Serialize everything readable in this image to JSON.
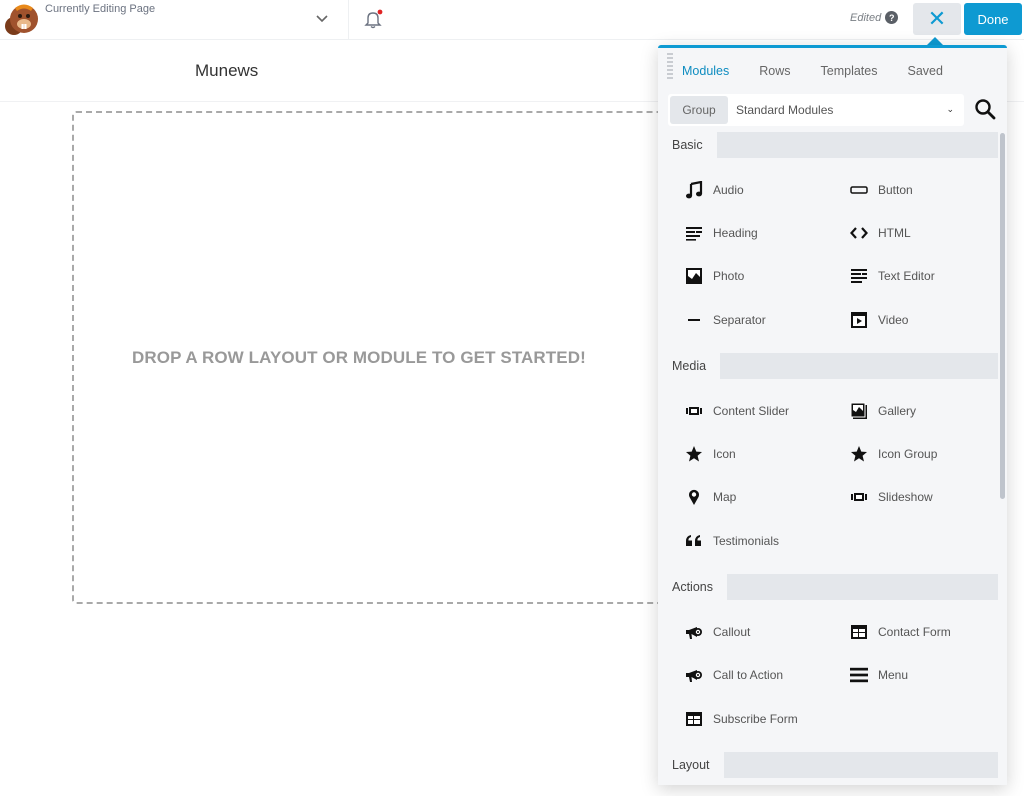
{
  "topbar": {
    "page_label": "Currently Editing Page",
    "edited_label": "Edited",
    "help_glyph": "?",
    "close_glyph": "✕",
    "done_label": "Done",
    "notification_dot": true
  },
  "canvas": {
    "site_title": "Munews",
    "drop_message": "DROP A ROW LAYOUT OR MODULE TO GET STARTED!"
  },
  "panel": {
    "tabs": [
      {
        "label": "Modules",
        "active": true
      },
      {
        "label": "Rows",
        "active": false
      },
      {
        "label": "Templates",
        "active": false
      },
      {
        "label": "Saved",
        "active": false
      }
    ],
    "group_label": "Group",
    "group_value": "Standard Modules",
    "sections": [
      {
        "title": "Basic",
        "items": [
          {
            "label": "Audio",
            "icon": "music-note-icon"
          },
          {
            "label": "Button",
            "icon": "button-icon"
          },
          {
            "label": "Heading",
            "icon": "heading-icon"
          },
          {
            "label": "HTML",
            "icon": "code-icon"
          },
          {
            "label": "Photo",
            "icon": "photo-icon"
          },
          {
            "label": "Text Editor",
            "icon": "text-editor-icon"
          },
          {
            "label": "Separator",
            "icon": "separator-icon"
          },
          {
            "label": "Video",
            "icon": "video-icon"
          }
        ]
      },
      {
        "title": "Media",
        "items": [
          {
            "label": "Content Slider",
            "icon": "slider-icon"
          },
          {
            "label": "Gallery",
            "icon": "gallery-icon"
          },
          {
            "label": "Icon",
            "icon": "star-icon"
          },
          {
            "label": "Icon Group",
            "icon": "star-icon"
          },
          {
            "label": "Map",
            "icon": "map-pin-icon"
          },
          {
            "label": "Slideshow",
            "icon": "slider-icon"
          },
          {
            "label": "Testimonials",
            "icon": "quote-icon"
          }
        ]
      },
      {
        "title": "Actions",
        "items": [
          {
            "label": "Callout",
            "icon": "megaphone-icon"
          },
          {
            "label": "Contact Form",
            "icon": "form-icon"
          },
          {
            "label": "Call to Action",
            "icon": "megaphone-icon"
          },
          {
            "label": "Menu",
            "icon": "menu-icon"
          },
          {
            "label": "Subscribe Form",
            "icon": "form-icon"
          }
        ]
      },
      {
        "title": "Layout",
        "items": []
      }
    ]
  },
  "colors": {
    "accent": "#0e9ad2",
    "tab_active": "#0e8cc0",
    "panel_bg": "#f5f6f8",
    "section_bg": "#e4e7eb",
    "notification": "#e02424"
  }
}
